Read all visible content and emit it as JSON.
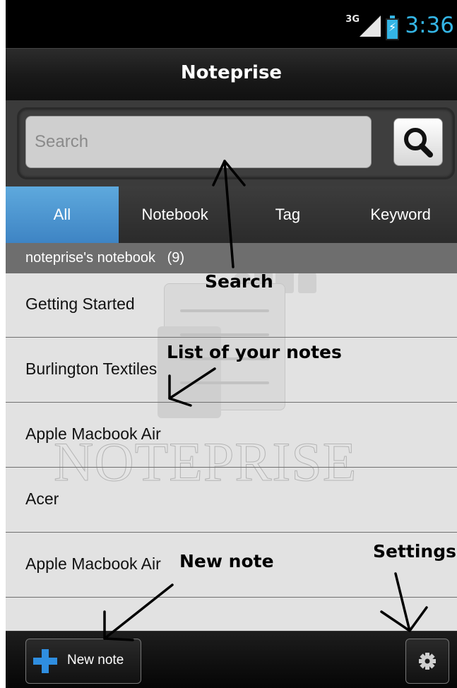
{
  "status_bar": {
    "network": "3G",
    "time": "3:36"
  },
  "app": {
    "title": "Noteprise"
  },
  "search": {
    "placeholder": "Search"
  },
  "tabs": [
    {
      "label": "All",
      "active": true
    },
    {
      "label": "Notebook",
      "active": false
    },
    {
      "label": "Tag",
      "active": false
    },
    {
      "label": "Keyword",
      "active": false
    }
  ],
  "notebook": {
    "name": "noteprise's notebook",
    "count": "(9)"
  },
  "notes": [
    {
      "title": "Getting Started"
    },
    {
      "title": "Burlington Textiles"
    },
    {
      "title": "Apple Macbook Air"
    },
    {
      "title": "Acer"
    },
    {
      "title": "Apple Macbook Air"
    }
  ],
  "watermark": {
    "text": "NOTEPRISE"
  },
  "bottom_bar": {
    "new_note_label": "New note"
  },
  "annotations": {
    "search": "Search",
    "list": "List of your notes",
    "new_note": "New note",
    "settings": "Settings"
  },
  "colors": {
    "accent": "#34b5e5",
    "tab_active": "#4e97d3",
    "plus": "#2f8ee0"
  }
}
